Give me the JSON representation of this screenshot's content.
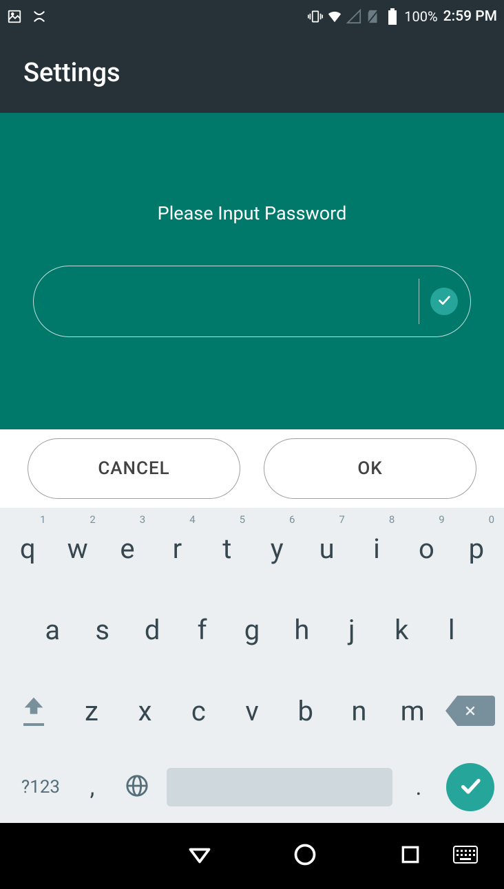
{
  "status_bar": {
    "battery_pct": "100%",
    "time": "2:59 PM"
  },
  "app_bar": {
    "title": "Settings"
  },
  "dialog": {
    "prompt": "Please Input Password",
    "password_value": ""
  },
  "buttons": {
    "cancel": "CANCEL",
    "ok": "OK"
  },
  "keyboard": {
    "row1": [
      {
        "key": "q",
        "hint": "1"
      },
      {
        "key": "w",
        "hint": "2"
      },
      {
        "key": "e",
        "hint": "3"
      },
      {
        "key": "r",
        "hint": "4"
      },
      {
        "key": "t",
        "hint": "5"
      },
      {
        "key": "y",
        "hint": "6"
      },
      {
        "key": "u",
        "hint": "7"
      },
      {
        "key": "i",
        "hint": "8"
      },
      {
        "key": "o",
        "hint": "9"
      },
      {
        "key": "p",
        "hint": "0"
      }
    ],
    "row2": [
      {
        "key": "a"
      },
      {
        "key": "s"
      },
      {
        "key": "d"
      },
      {
        "key": "f"
      },
      {
        "key": "g"
      },
      {
        "key": "h"
      },
      {
        "key": "j"
      },
      {
        "key": "k"
      },
      {
        "key": "l"
      }
    ],
    "row3": [
      {
        "key": "z"
      },
      {
        "key": "x"
      },
      {
        "key": "c"
      },
      {
        "key": "v"
      },
      {
        "key": "b"
      },
      {
        "key": "n"
      },
      {
        "key": "m"
      }
    ],
    "sym_label": "?123",
    "comma": ",",
    "dot": "."
  }
}
